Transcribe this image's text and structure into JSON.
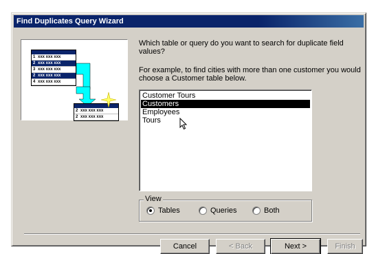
{
  "window": {
    "title": "Find Duplicates Query Wizard"
  },
  "illustration": {
    "left_table_rows": [
      {
        "num": "1",
        "text": "xxx xxx xxx",
        "highlight": false
      },
      {
        "num": "2",
        "text": "xxx xxx xxx",
        "highlight": true
      },
      {
        "num": "3",
        "text": "xxx xxx xxx",
        "highlight": false
      },
      {
        "num": "2",
        "text": "xxx xxx xxx",
        "highlight": true
      },
      {
        "num": "4",
        "text": "xxx xxx xxx",
        "highlight": false
      }
    ],
    "result_table_rows": [
      {
        "num": "2",
        "text": "xxx xxx xxx"
      },
      {
        "num": "2",
        "text": "xxx xxx xxx"
      }
    ],
    "arrow_color": "#00ffff",
    "sparkle_color": "#ffff66"
  },
  "wizard": {
    "question": "Which table or query do you want to search for duplicate field values?",
    "example": "For example, to find cities with more than one customer you would choose a Customer table below."
  },
  "list": {
    "items": [
      "Customer Tours",
      "Customers",
      "Employees",
      "Tours"
    ],
    "selected_index": 1
  },
  "view": {
    "legend": "View",
    "options": [
      "Tables",
      "Queries",
      "Both"
    ],
    "selected": "Tables"
  },
  "buttons": {
    "cancel": "Cancel",
    "back": "< Back",
    "next": "Next >",
    "finish": "Finish"
  }
}
